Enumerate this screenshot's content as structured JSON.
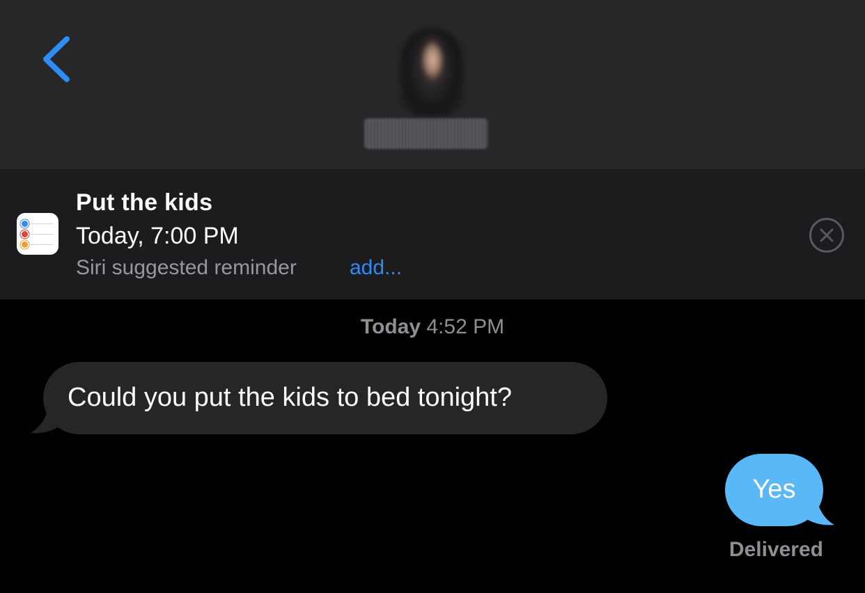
{
  "header": {
    "back_icon": "chevron-left-icon",
    "contact_avatar": "blurred-contact-photo",
    "accent_color": "#2f8cf7"
  },
  "suggestion": {
    "app_icon": "reminders-app-icon",
    "title": "Put the kids",
    "time": "Today, 7:00 PM",
    "subtitle": "Siri suggested reminder",
    "add_label": "add...",
    "dismiss_icon": "close-circle-icon"
  },
  "conversation": {
    "timestamp_day": "Today",
    "timestamp_time": "4:52 PM",
    "messages": [
      {
        "direction": "incoming",
        "text": "Could you put the kids to bed tonight?"
      },
      {
        "direction": "outgoing",
        "text": "Yes"
      }
    ],
    "status": "Delivered",
    "colors": {
      "incoming_bubble": "#262628",
      "outgoing_bubble": "#5ab8f7"
    }
  }
}
